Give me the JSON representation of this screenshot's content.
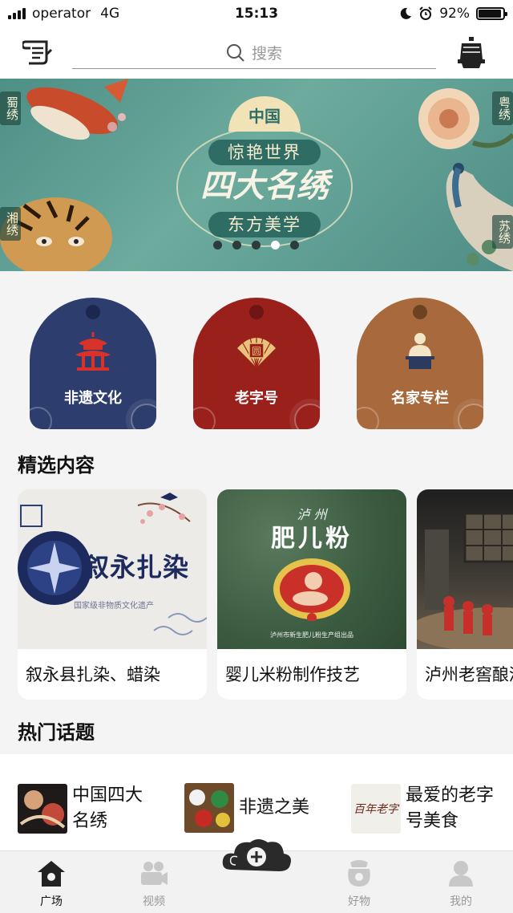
{
  "status_bar": {
    "carrier": "operator",
    "network": "4G",
    "time": "15:13",
    "battery": "92%",
    "battery_level": 0.92
  },
  "header": {
    "search_placeholder": "搜索",
    "left_icon": "scroll-icon",
    "right_icon": "bell-icon"
  },
  "banner": {
    "country": "中国",
    "line1": "惊艳世界",
    "title": "四大名绣",
    "line2": "东方美学",
    "tags": [
      "蜀绣",
      "湘绣",
      "粤绣",
      "苏绣"
    ],
    "dots_count": 5,
    "active_dot": 3
  },
  "categories": [
    {
      "label": "非遗文化",
      "color": "#2d3d6e",
      "hole": "#1c2750",
      "icon": "pavilion-icon"
    },
    {
      "label": "老字号",
      "color": "#9a201c",
      "hole": "#6c1512",
      "icon": "fan-icon"
    },
    {
      "label": "名家专栏",
      "color": "#a8693c",
      "hole": "#6d4222",
      "icon": "master-icon"
    }
  ],
  "featured": {
    "title": "精选内容",
    "items": [
      {
        "caption": "叙永县扎染、蜡染",
        "thumb_title": "叙永扎染",
        "thumb_sub": "国家级非物质文化遗产"
      },
      {
        "caption": "婴儿米粉制作技艺",
        "thumb_title": "肥儿粉",
        "thumb_top": "泸 州",
        "thumb_sub": "泸州市新生肥儿粉生产组出品"
      },
      {
        "caption": "泸州老窖酿酒技艺"
      }
    ]
  },
  "topics": {
    "title": "热门话题",
    "items": [
      {
        "line1": "中国四大",
        "line2": "名绣"
      },
      {
        "line1": "非遗之美",
        "line2": ""
      },
      {
        "line1": "最爱的老字",
        "line2": "号美食",
        "thumb_text": "百年老字"
      }
    ]
  },
  "tabbar": {
    "items": [
      {
        "label": "广场",
        "icon": "home-icon",
        "active": true
      },
      {
        "label": "视频",
        "icon": "video-camera-icon",
        "active": false
      },
      {
        "label": "好物",
        "icon": "gift-bag-icon",
        "active": false
      },
      {
        "label": "我的",
        "icon": "user-icon",
        "active": false
      }
    ],
    "fab_icon": "plus-cloud-icon"
  }
}
